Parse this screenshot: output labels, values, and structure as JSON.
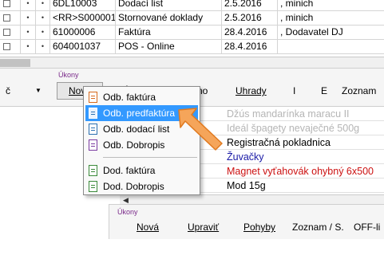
{
  "top_table": {
    "rows": [
      {
        "num": "6DL10003",
        "type": "Dodací list",
        "date": "2.5.2016",
        "partner": ", minich"
      },
      {
        "num": "<RR>S000001",
        "type": "Stornované doklady",
        "date": "2.5.2016",
        "partner": ", minich"
      },
      {
        "num": "61000006",
        "type": "Faktúra",
        "date": "28.4.2016",
        "partner": ", Dodavatel DJ"
      },
      {
        "num": "604001037",
        "type": "POS - Online",
        "date": "28.4.2016",
        "partner": ""
      }
    ],
    "bullet": "•"
  },
  "ribbon": {
    "group_label": "Úkony",
    "left_label": "č",
    "nova": "Nová",
    "upravit_partial": "Ú",
    "storno_partial": "Storno",
    "uhrady": "Uhrady",
    "i": "I",
    "e": "E",
    "zoznam": "Zoznam",
    "dropdown_arrow": "▼"
  },
  "menu": {
    "items": [
      {
        "label": "Odb. faktúra",
        "icon": "invoice-icon"
      },
      {
        "label": "Odb. predfaktúra",
        "icon": "proforma-icon"
      },
      {
        "label": "Odb. dodací list",
        "icon": "delivery-note-icon"
      },
      {
        "label": "Odb. Dobropis",
        "icon": "credit-note-icon"
      },
      {
        "label": "Dod. faktúra",
        "icon": "supplier-invoice-icon"
      },
      {
        "label": "Dod. Dobropis",
        "icon": "supplier-credit-note-icon"
      }
    ]
  },
  "lower_table": {
    "rows": [
      {
        "text": "Džús mandarínka maracu II"
      },
      {
        "text": "Ideál špagety nevaječné 500g"
      },
      {
        "text": "Registračná pokladnica"
      },
      {
        "text": "Žuvačky"
      },
      {
        "text": "Magnet vyťahovák ohybný 6x500"
      },
      {
        "text": "Mod 15g"
      }
    ],
    "scroll_arrow": "◀"
  },
  "lower_ribbon": {
    "group_label": "Úkony",
    "nova": "Nová",
    "upravit": "Upraviť",
    "pohyby": "Pohyby",
    "zoznam": "Zoznam / S.",
    "offline": "OFF-li"
  },
  "colors": {
    "accent_selection": "#3399ff",
    "group_label": "#7a2a8a",
    "callout_arrow": "#f5a55a"
  }
}
